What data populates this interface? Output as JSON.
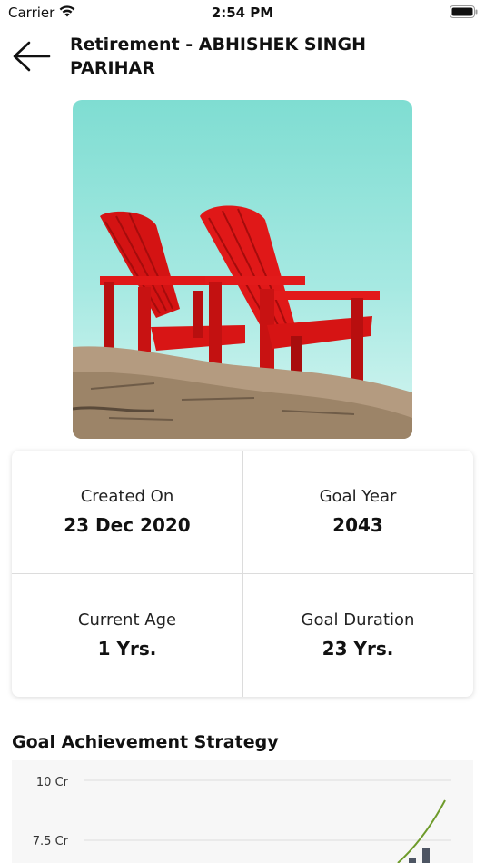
{
  "status_bar": {
    "carrier": "Carrier",
    "time": "2:54 PM"
  },
  "header": {
    "title": "Retirement - ABHISHEK SINGH PARIHAR"
  },
  "details": {
    "created_label": "Created On",
    "created_value": "23 Dec 2020",
    "goal_year_label": "Goal Year",
    "goal_year_value": "2043",
    "age_label": "Current Age",
    "age_value": "1 Yrs.",
    "duration_label": "Goal Duration",
    "duration_value": "23 Yrs."
  },
  "strategy": {
    "title": "Goal Achievement Strategy"
  },
  "chart_data": {
    "type": "line",
    "y_ticks": [
      "10 Cr",
      "7.5 Cr"
    ],
    "series_color": "#6e9b2b",
    "bar_color": "#4d5563"
  }
}
